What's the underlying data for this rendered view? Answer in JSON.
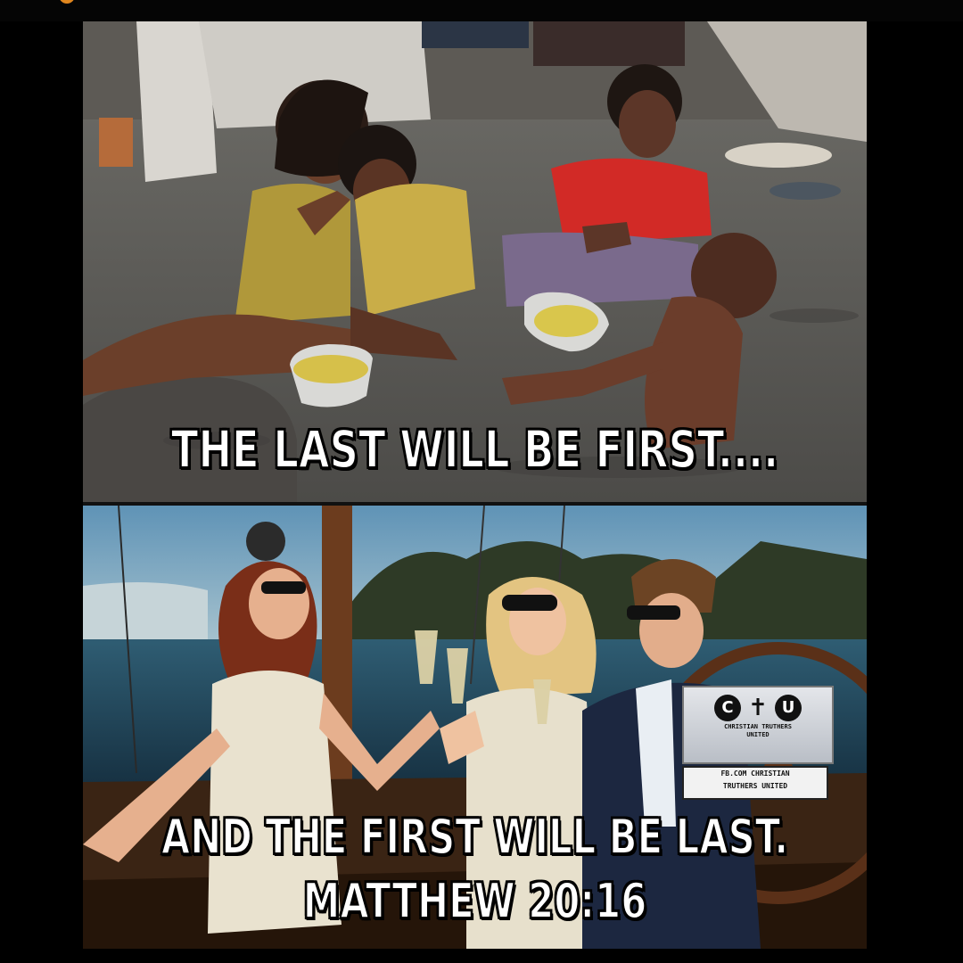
{
  "meme": {
    "top_caption": "THE LAST WILL BE FIRST....",
    "bottom_caption_line1": "AND THE FIRST WILL BE LAST.",
    "bottom_caption_line2": "MATTHEW 20:16"
  },
  "watermark": {
    "logo_letters": [
      "C",
      "U"
    ],
    "logo_line1": "CHRISTIAN TRUTHERS",
    "logo_line2": "UNITED",
    "fb_line1": "FB.COM CHRISTIAN",
    "fb_line2": "TRUTHERS UNITED"
  },
  "colors": {
    "background": "#000000",
    "caption_text": "#ffffff",
    "caption_outline": "#000000",
    "accent_dot": "#e0861e"
  }
}
